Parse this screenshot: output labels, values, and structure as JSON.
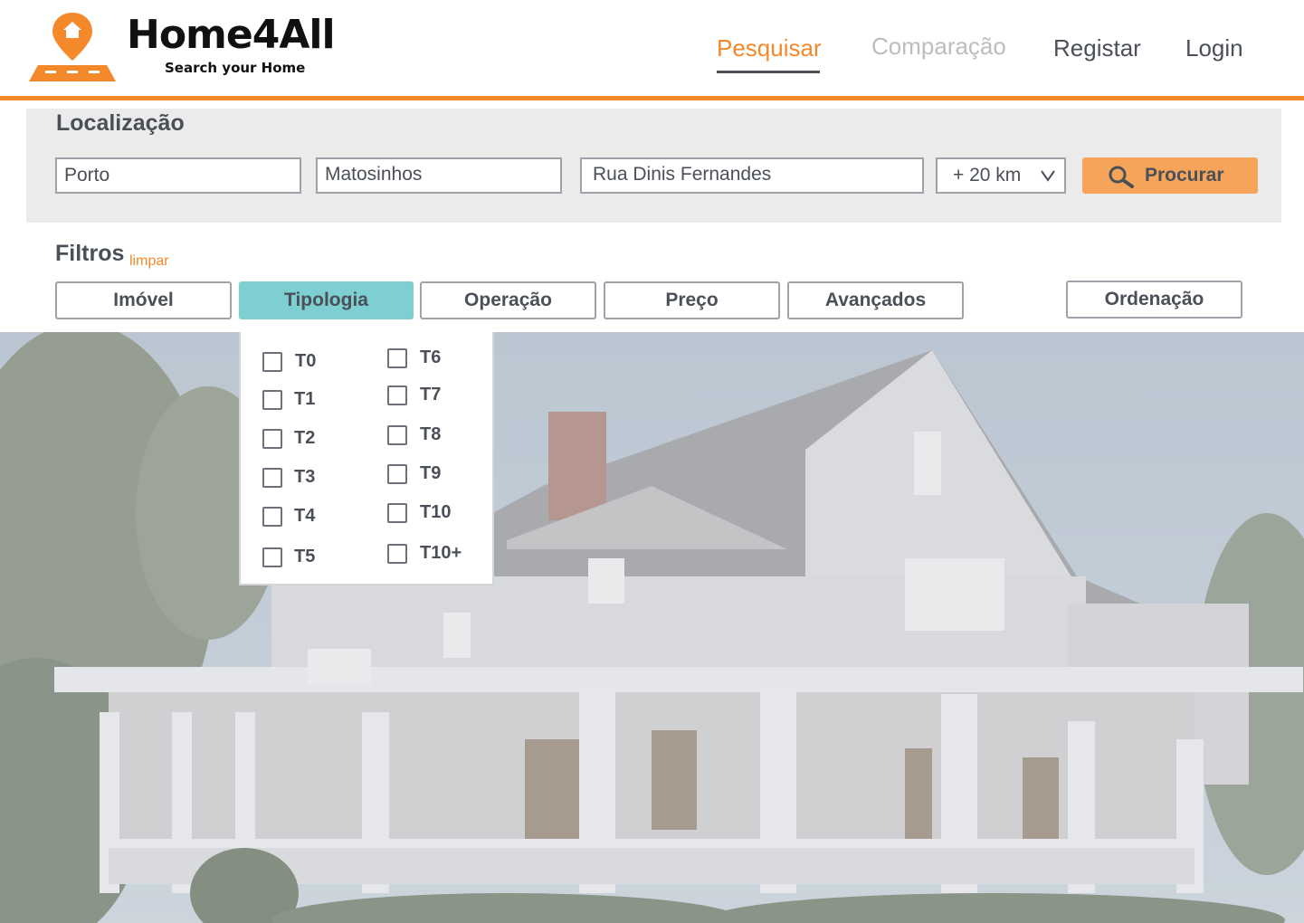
{
  "brand": {
    "name": "Home4All",
    "tagline": "Search your Home"
  },
  "nav": [
    {
      "label": "Pesquisar",
      "state": "active"
    },
    {
      "label": "Comparação",
      "state": "disabled"
    },
    {
      "label": "Registar",
      "state": "normal"
    },
    {
      "label": "Login",
      "state": "normal"
    }
  ],
  "location": {
    "title": "Localização",
    "district": "Porto",
    "municipality": "Matosinhos",
    "street": "Rua Dinis Fernandes",
    "radius": "+ 20 km",
    "search_label": "Procurar"
  },
  "filters": {
    "title": "Filtros",
    "clear_label": "limpar",
    "tabs": [
      {
        "label": "Imóvel",
        "active": false
      },
      {
        "label": "Tipologia",
        "active": true
      },
      {
        "label": "Operação",
        "active": false
      },
      {
        "label": "Preço",
        "active": false
      },
      {
        "label": "Avançados",
        "active": false
      }
    ],
    "sort_label": "Ordenação"
  },
  "tipologia": {
    "left": [
      "T0",
      "T1",
      "T2",
      "T3",
      "T4",
      "T5"
    ],
    "right": [
      "T6",
      "T7",
      "T8",
      "T9",
      "T10",
      "T10+"
    ]
  },
  "colors": {
    "accent": "#f4892b",
    "active_tab": "#7dcfd1",
    "search_button": "#f6a45a",
    "text": "#4b5058"
  }
}
